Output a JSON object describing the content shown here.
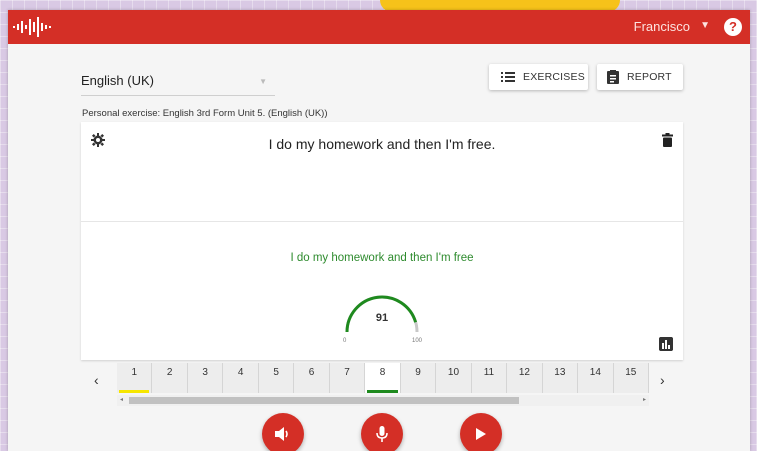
{
  "header": {
    "user_name": "Francisco",
    "help_label": "?"
  },
  "colors": {
    "brand": "#d42f26",
    "success": "#2e8b2e",
    "marker_yellow": "#f6e600",
    "marker_green": "#1e8a1e"
  },
  "language": {
    "selected": "English (UK)"
  },
  "toolbar": {
    "exercises_label": "EXERCISES",
    "report_label": "REPORT"
  },
  "exercise": {
    "title": "Personal exercise: English 3rd Form Unit 5. (English (UK))",
    "sentence": "I do my homework and then I'm free.",
    "recognized": "I do my homework and then I'm free",
    "score": "91",
    "score_min": "0",
    "score_max": "100",
    "score_fraction": 0.91
  },
  "pager": {
    "items": [
      "1",
      "2",
      "3",
      "4",
      "5",
      "6",
      "7",
      "8",
      "9",
      "10",
      "11",
      "12",
      "13",
      "14",
      "15"
    ],
    "current": "8",
    "markers": {
      "1": "yellow",
      "8": "green"
    }
  },
  "icons": {
    "logo": "soundwave-logo",
    "user_menu": "chevron-down-icon",
    "help": "help-icon",
    "exercises": "list-icon",
    "report": "report-icon",
    "settings": "gear-icon",
    "delete": "trash-icon",
    "stats": "bar-chart-icon",
    "prev": "chevron-left-icon",
    "next": "chevron-right-icon",
    "speak": "speaker-icon",
    "record": "microphone-icon",
    "play": "play-icon"
  }
}
